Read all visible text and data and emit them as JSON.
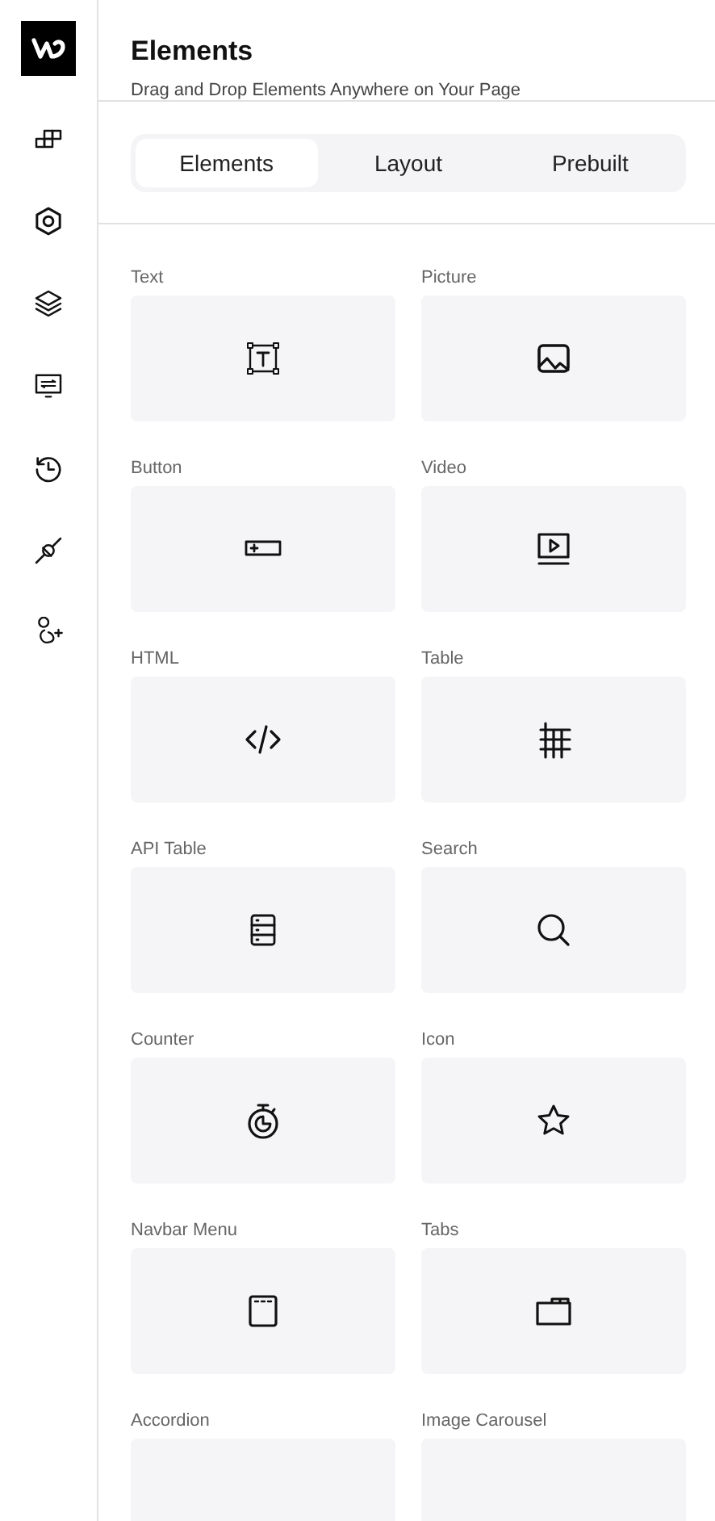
{
  "panel": {
    "title": "Elements",
    "subtitle": "Drag and Drop Elements Anywhere on Your Page"
  },
  "tabs": [
    {
      "label": "Elements",
      "selected": true
    },
    {
      "label": "Layout",
      "selected": false
    },
    {
      "label": "Prebuilt",
      "selected": false
    }
  ],
  "elements": [
    {
      "label": "Text",
      "kind": "text"
    },
    {
      "label": "Picture",
      "kind": "picture"
    },
    {
      "label": "Button",
      "kind": "button"
    },
    {
      "label": "Video",
      "kind": "video"
    },
    {
      "label": "HTML",
      "kind": "html"
    },
    {
      "label": "Table",
      "kind": "table"
    },
    {
      "label": "API Table",
      "kind": "api"
    },
    {
      "label": "Search",
      "kind": "search"
    },
    {
      "label": "Counter",
      "kind": "counter"
    },
    {
      "label": "Icon",
      "kind": "icon"
    },
    {
      "label": "Navbar Menu",
      "kind": "navbar"
    },
    {
      "label": "Tabs",
      "kind": "tabs"
    },
    {
      "label": "Accordion",
      "kind": "blank"
    },
    {
      "label": "Image Carousel",
      "kind": "blank"
    }
  ]
}
